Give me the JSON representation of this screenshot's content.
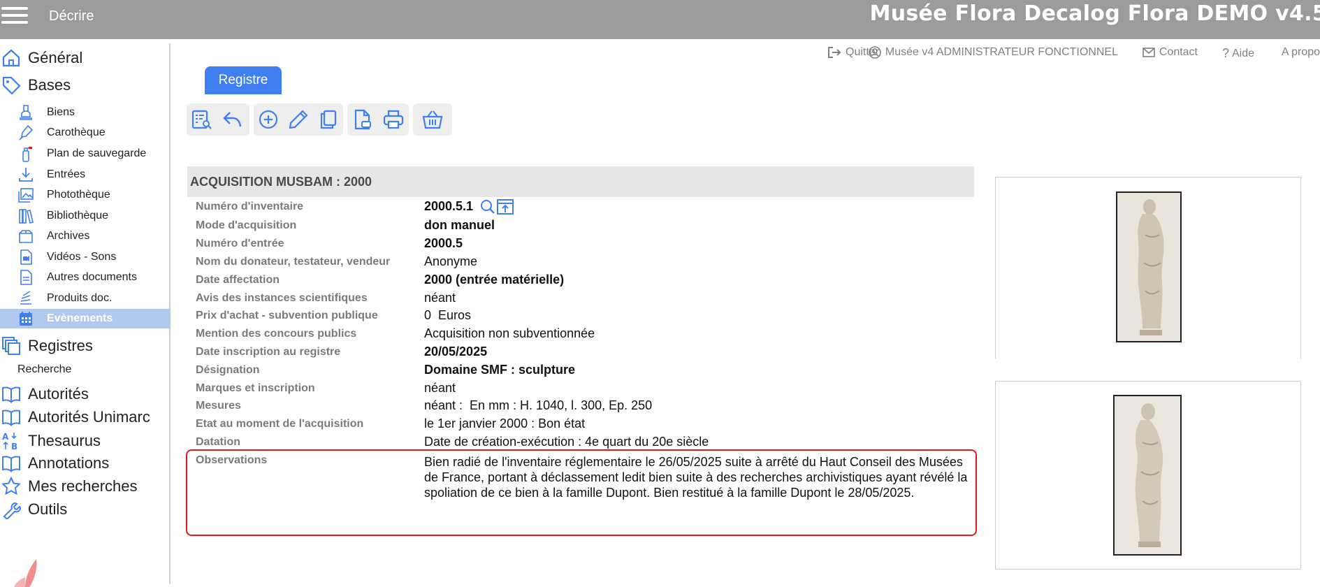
{
  "header": {
    "menu_title": "Décrire",
    "app_title": "Musée Flora Decalog Flora DEMO v4.5"
  },
  "utility": {
    "quit": "Quitter",
    "user": "Musée v4 ADMINISTRATEUR FONCTIONNEL",
    "contact": "Contact",
    "help": "Aide",
    "about": "A propos"
  },
  "sidebar": {
    "general": "Général",
    "bases": "Bases",
    "sub_items": [
      {
        "label": "Biens",
        "icon": "bust-icon"
      },
      {
        "label": "Carothèque",
        "icon": "pen-nib-icon"
      },
      {
        "label": "Plan de sauvegarde",
        "icon": "fire-extinguisher-icon"
      },
      {
        "label": "Entrées",
        "icon": "download-icon"
      },
      {
        "label": "Photothèque",
        "icon": "images-icon"
      },
      {
        "label": "Bibliothèque",
        "icon": "books-icon"
      },
      {
        "label": "Archives",
        "icon": "archive-box-icon"
      },
      {
        "label": "Vidéos - Sons",
        "icon": "video-file-icon"
      },
      {
        "label": "Autres documents",
        "icon": "document-icon"
      },
      {
        "label": "Produits doc.",
        "icon": "stack-icon"
      },
      {
        "label": "Evènements",
        "icon": "calendar-icon",
        "active": true
      }
    ],
    "registres": "Registres",
    "recherche": "Recherche",
    "autorites": "Autorités",
    "autorites_unimarc": "Autorités Unimarc",
    "thesaurus": "Thesaurus",
    "annotations": "Annotations",
    "mes_recherches": "Mes recherches",
    "outils": "Outils",
    "accent_color": "#3f7ff0",
    "active_bg": "#b3c8ef"
  },
  "tab": {
    "label": "Registre"
  },
  "record": {
    "title": "ACQUISITION MUSBAM : 2000",
    "fields": [
      {
        "label": "Numéro d'inventaire",
        "value": "2000.5.1",
        "bold": true
      },
      {
        "label": "Mode d'acquisition",
        "value": "don manuel",
        "bold": true
      },
      {
        "label": "Numéro d'entrée",
        "value": "2000.5",
        "bold": true
      },
      {
        "label": "Nom du donateur, testateur, vendeur",
        "value": "Anonyme",
        "bold": false
      },
      {
        "label": "Date affectation",
        "value": "2000 (entrée matérielle)",
        "bold": true
      },
      {
        "label": "Avis des instances scientifiques",
        "value": "néant",
        "bold": false
      },
      {
        "label": "Prix d'achat - subvention publique",
        "value": "0  Euros",
        "bold": false
      },
      {
        "label": "Mention des concours publics",
        "value": "Acquisition non subventionnée",
        "bold": false
      },
      {
        "label": "Date inscription au registre",
        "value": "20/05/2025",
        "bold": true
      },
      {
        "label": "Désignation",
        "value": "Domaine SMF : sculpture",
        "bold": true
      },
      {
        "label": "Marques et inscription",
        "value": "néant",
        "bold": false
      },
      {
        "label": "Mesures",
        "value": "néant :  En mm : H. 1040, l. 300, Ep. 250",
        "bold": false
      },
      {
        "label": "Etat au moment de l'acquisition",
        "value": "le 1er janvier 2000 : Bon état",
        "bold": false
      },
      {
        "label": "Datation",
        "value": "Date de création-exécution : 4e quart du 20e siècle",
        "bold": false
      }
    ],
    "observations_label": "Observations",
    "observations": "Bien radié de l'inventaire réglementaire le 26/05/2025 suite à arrêté du Haut Conseil des Musées de France, portant à déclassement ledit bien suite à des recherches archivistiques ayant révélé la spoliation de ce bien à la famille Dupont. Bien restitué à la famille Dupont le 28/05/2025.",
    "highlight_color": "#e5161c"
  }
}
